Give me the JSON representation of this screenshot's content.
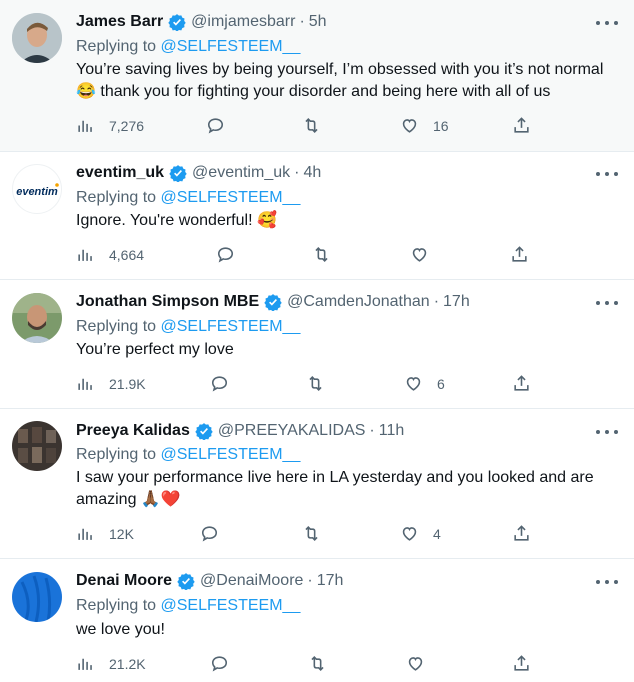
{
  "reply_prefix": "Replying to",
  "tweets": [
    {
      "name": "James Barr",
      "handle": "@imjamesbarr",
      "sep": "·",
      "time": "5h",
      "reply_to": "@SELFESTEEM__",
      "text": "You’re saving lives by being yourself, I’m obsessed with you it’s not normal 😂 thank you for fighting your disorder and being here with all of us",
      "views": "7,276",
      "likes": "16"
    },
    {
      "name": "eventim_uk",
      "handle": "@eventim_uk",
      "sep": "·",
      "time": "4h",
      "avatar_text": "eventim",
      "reply_to": "@SELFESTEEM__",
      "text": "Ignore. You're wonderful! 🥰",
      "views": "4,664",
      "likes": ""
    },
    {
      "name": "Jonathan Simpson MBE",
      "handle": "@CamdenJonathan",
      "sep": "·",
      "time": "17h",
      "reply_to": "@SELFESTEEM__",
      "text": "You’re perfect my love",
      "views": "21.9K",
      "likes": "6"
    },
    {
      "name": "Preeya Kalidas",
      "handle": "@PREEYAKALIDAS",
      "sep": "·",
      "time": "11h",
      "reply_to": "@SELFESTEEM__",
      "text": "I saw your performance live here in LA yesterday and you looked and are amazing 🙏🏾❤️",
      "views": "12K",
      "likes": "4"
    },
    {
      "name": "Denai Moore",
      "handle": "@DenaiMoore",
      "sep": "·",
      "time": "17h",
      "reply_to": "@SELFESTEEM__",
      "text": "we love you!",
      "views": "21.2K",
      "likes": ""
    }
  ],
  "colors": {
    "link": "#1d9bf0",
    "muted": "#536471",
    "text": "#0f1419",
    "highlight_bg": "#f7f9f9",
    "verified": "#1d9bf0"
  },
  "icons": [
    "views-icon",
    "reply-icon",
    "retweet-icon",
    "like-icon",
    "share-icon",
    "verified-icon",
    "more-icon"
  ]
}
